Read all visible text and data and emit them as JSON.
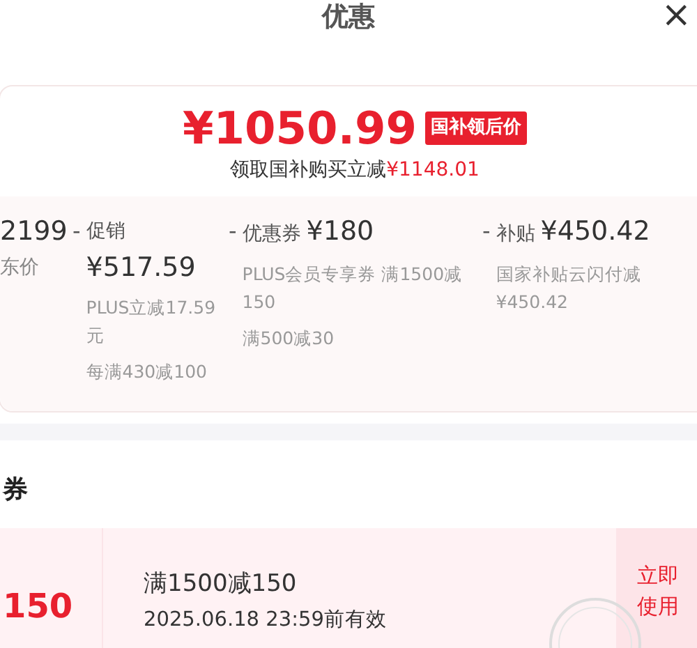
{
  "header": {
    "title": "优惠",
    "close": "×"
  },
  "summary": {
    "price": "¥1050.99",
    "badge": "国补领后价",
    "note_prefix": "领取国补购买立减",
    "note_amount": "¥1148.01"
  },
  "breakdown": [
    {
      "kind": "base",
      "amount": "2199",
      "label": "东价"
    },
    {
      "kind": "item",
      "sign": "-",
      "label": "促销",
      "amount": "¥517.59",
      "details": [
        "PLUS立减17.59元",
        "每满430减100"
      ]
    },
    {
      "kind": "item",
      "sign": "-",
      "label": "优惠券",
      "amount": "¥180",
      "details": [
        "PLUS会员专享券 满1500减150",
        "满500减30"
      ]
    },
    {
      "kind": "item",
      "sign": "-",
      "label": "补贴",
      "amount": "¥450.42",
      "details": [
        "国家补贴云闪付减¥450.42"
      ]
    }
  ],
  "coupons_section": {
    "title": "券",
    "coupons": [
      {
        "amount": "150",
        "condition": "满1500减150",
        "validity": "2025.06.18 23:59前有效",
        "action": "立即使用",
        "claimed": true
      }
    ]
  }
}
